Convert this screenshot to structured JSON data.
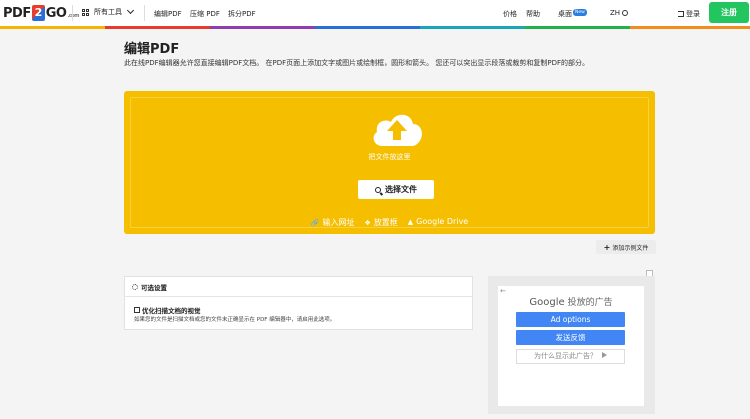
{
  "header": {
    "logo": {
      "left": "PDF",
      "mid": "2",
      "right": "GO",
      "suffix": ".com"
    },
    "all_tools": "所有工具",
    "nav": [
      "编辑PDF",
      "压缩 PDF",
      "拆分PDF"
    ],
    "right_nav": {
      "pricing": "价格",
      "help": "帮助",
      "desktop": "桌面",
      "desktop_badge": "New",
      "lang": "ZH",
      "login": "登录",
      "register": "注册"
    }
  },
  "page": {
    "title": "编辑PDF",
    "description": "此在线PDF编辑器允许您直接编辑PDF文档。 在PDF页面上添加文字或图片或绘制框，圆形和箭头。 您还可以突出显示段落或裁剪和复制PDF的部分。"
  },
  "uploader": {
    "drop_text": "把文件放这里",
    "choose_label": "选择文件",
    "sources": [
      {
        "icon": "link-icon",
        "label": "输入网址"
      },
      {
        "icon": "dropbox-icon",
        "label": "放置框"
      },
      {
        "icon": "google-drive-icon",
        "label": "Google Drive"
      }
    ]
  },
  "add_sample": "添加示例文件",
  "options": {
    "header": "可选设置",
    "checkbox_label": "优化扫描文档的视觉",
    "help": "如果您的文件是扫描文档或您的文件未正确显示在 PDF 编辑器中，请启用此选项。"
  },
  "ad": {
    "brand": "Google",
    "title": "投放的广告",
    "btn1": "Ad options",
    "btn2": "发送反馈",
    "why": "为什么显示此广告？"
  },
  "colors": {
    "accent": "#f5bf00",
    "register": "#22c55e",
    "ad_blue": "#4285f4"
  }
}
